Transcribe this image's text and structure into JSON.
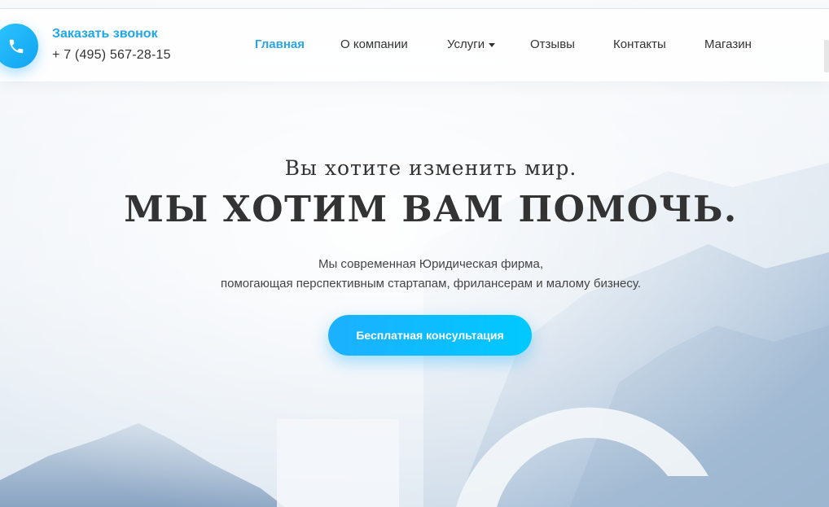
{
  "header": {
    "callback": {
      "title": "Заказать звонок",
      "phone": "+ 7 (495) 567-28-15",
      "icon": "phone-icon"
    },
    "nav": [
      {
        "label": "Главная",
        "active": true
      },
      {
        "label": "О компании",
        "active": false
      },
      {
        "label": "Услуги",
        "active": false,
        "dropdown": true
      },
      {
        "label": "Отзывы",
        "active": false
      },
      {
        "label": "Контакты",
        "active": false
      },
      {
        "label": "Магазин",
        "active": false
      }
    ]
  },
  "hero": {
    "subtitle": "Вы хотите изменить мир.",
    "title": "МЫ ХОТИМ ВАМ ПОМОЧЬ.",
    "description_line1": "Мы современная Юридическая фирма,",
    "description_line2": "помогающая перспективным стартапам, фрилансерам и малому бизнесу.",
    "cta_label": "Бесплатная консультация"
  },
  "colors": {
    "accent": "#1ea7ea",
    "cta_start": "#1cb0ff",
    "cta_end": "#00c9ff",
    "text": "#333333"
  }
}
